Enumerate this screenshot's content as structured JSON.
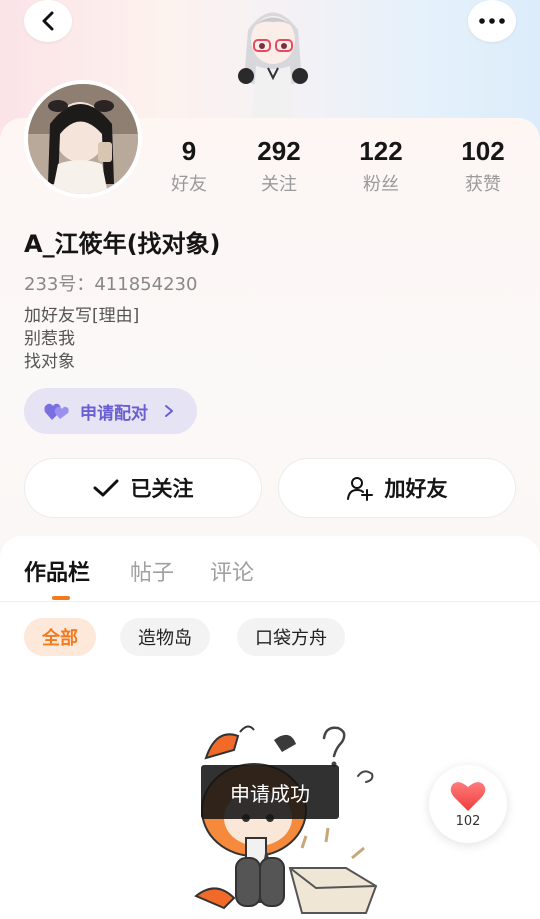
{
  "colors": {
    "accent": "#f47a1f",
    "pair": "#6a5fd1",
    "heart": "#f24a4a"
  },
  "header": {
    "back_icon": "chevron-left-icon",
    "more_icon": "more-dots-icon"
  },
  "profile": {
    "name": "A_江筱年(找对象)",
    "uid": "233号：411854230",
    "bio": [
      "加好友写[理由]",
      "别惹我",
      "找对象"
    ]
  },
  "stats": [
    {
      "value": "9",
      "label": "好友"
    },
    {
      "value": "292",
      "label": "关注"
    },
    {
      "value": "122",
      "label": "粉丝"
    },
    {
      "value": "102",
      "label": "获赞"
    }
  ],
  "pair_button": {
    "label": "申请配对"
  },
  "actions": {
    "followed_label": "已关注",
    "add_friend_label": "加好友"
  },
  "tabs": [
    {
      "label": "作品栏",
      "active": true
    },
    {
      "label": "帖子",
      "active": false
    },
    {
      "label": "评论",
      "active": false
    }
  ],
  "chips": [
    {
      "label": "全部",
      "active": true
    },
    {
      "label": "造物岛",
      "active": false
    },
    {
      "label": "口袋方舟",
      "active": false
    }
  ],
  "toast": "申请成功",
  "like": {
    "count": "102"
  }
}
